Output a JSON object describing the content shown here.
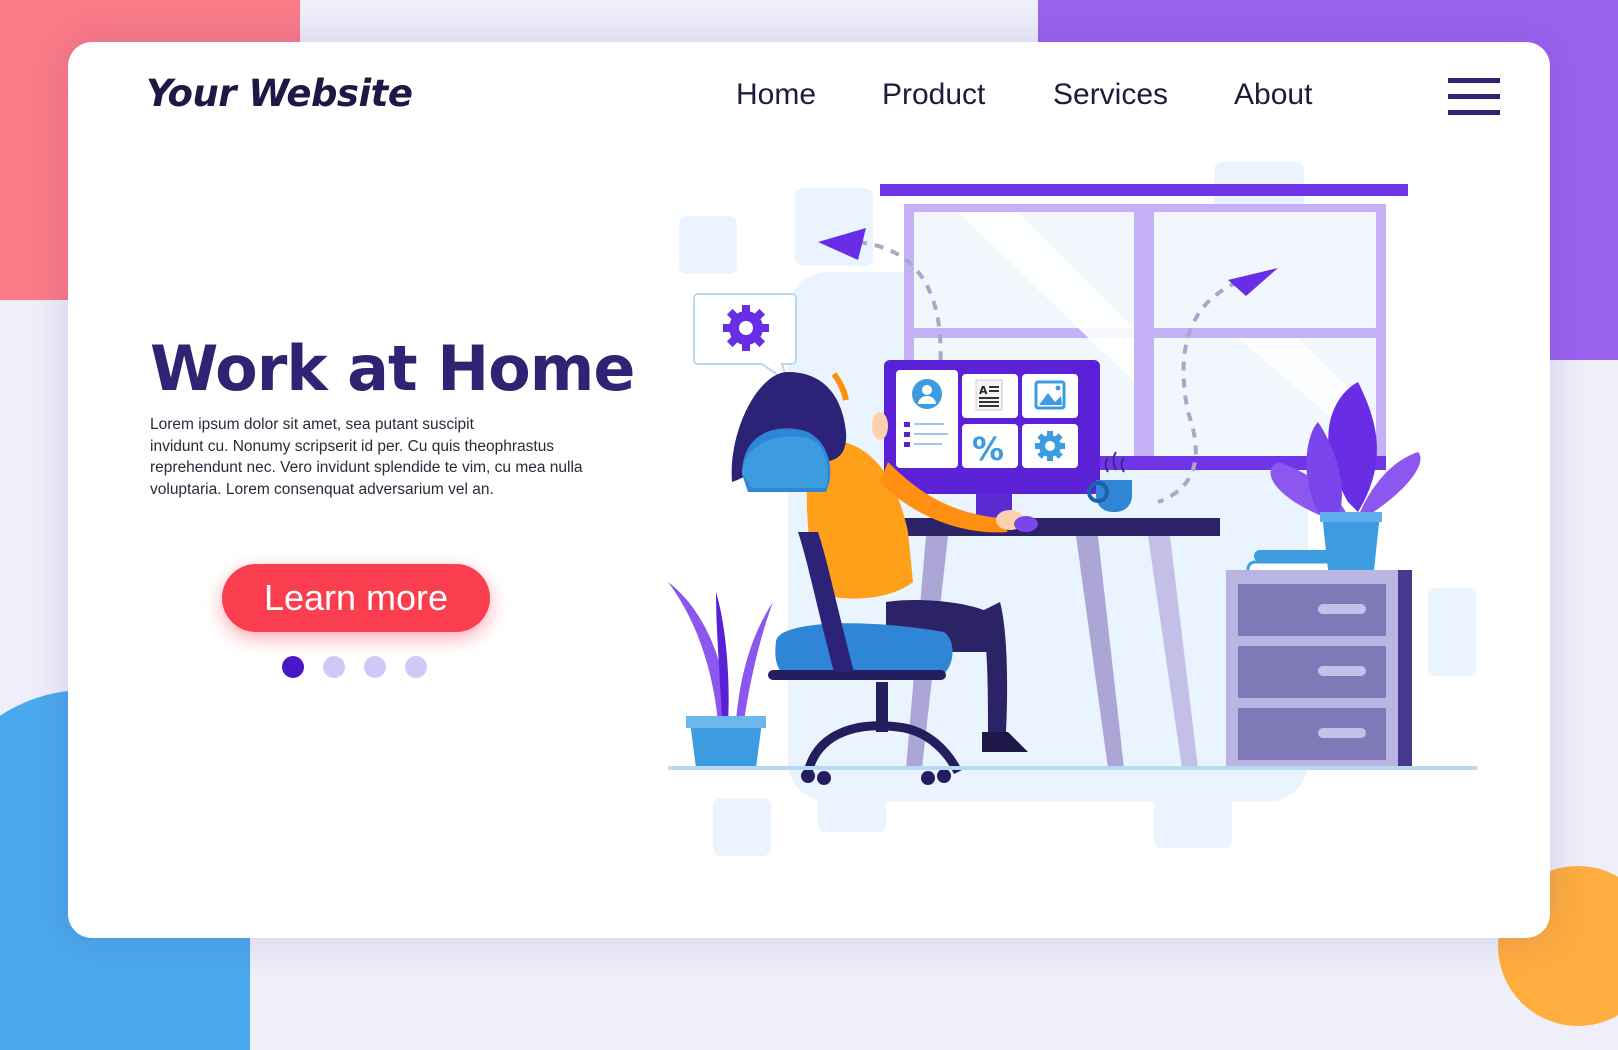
{
  "header": {
    "logo": "Your Website",
    "nav": [
      {
        "label": "Home"
      },
      {
        "label": "Product"
      },
      {
        "label": "Services"
      },
      {
        "label": "About"
      }
    ],
    "menu_icon": "hamburger-menu-icon"
  },
  "hero": {
    "title": "Work at Home",
    "description": "Lorem ipsum dolor sit amet, sea putant suscipit invidunt cu. Nonumy scripserit id per. Cu quis theophrastus reprehendunt nec. Vero invidunt splendide te vim, cu mea nulla voluptaria. Lorem consenquat adversarium vel an.",
    "description_lines": [
      "Lorem ipsum dolor sit amet, sea putant suscipit",
      "invidunt cu. Nonumy scripserit id per. Cu quis theophrastus",
      "reprehendunt nec. Vero invidunt splendide te vim, cu mea nulla",
      "voluptaria. Lorem consenquat adversarium vel an."
    ],
    "cta_label": "Learn more",
    "carousel": {
      "total": 4,
      "active_index": 0
    }
  },
  "illustration": {
    "subject": "woman working at a desk computer at home",
    "screen_tiles": [
      "user-profile-icon",
      "document-icon",
      "image-icon",
      "percent-icon",
      "gear-icon"
    ],
    "speech_bubble_icon": "gear-icon",
    "percent_symbol": "%",
    "doc_letter": "A"
  },
  "colors": {
    "brand_dark": "#2e2473",
    "accent_red": "#fa3d4f",
    "purple": "#7c3aed",
    "blue": "#3d9be0",
    "orange": "#ff9f1c"
  }
}
